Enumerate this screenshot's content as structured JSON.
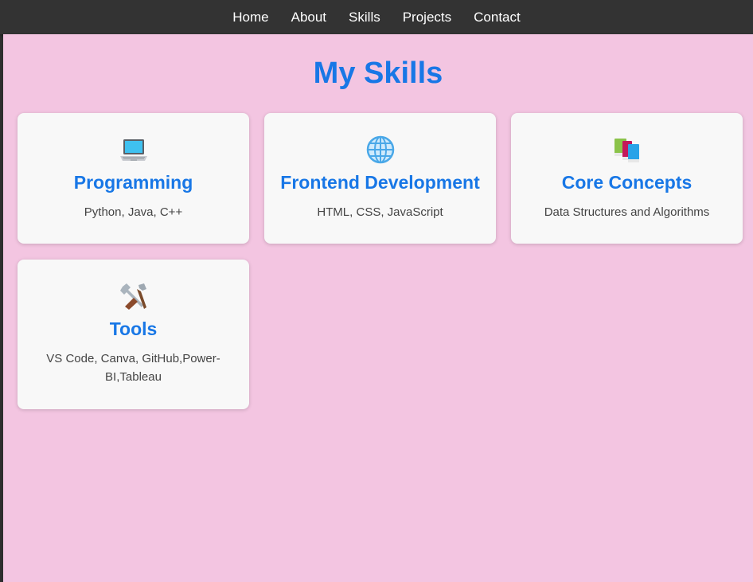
{
  "nav": {
    "items": [
      "Home",
      "About",
      "Skills",
      "Projects",
      "Contact"
    ]
  },
  "page": {
    "title": "My Skills",
    "background": "#f3c5e1",
    "accent": "#1877e6"
  },
  "skills": [
    {
      "icon": "laptop-icon",
      "title": "Programming",
      "description": "Python, Java, C++"
    },
    {
      "icon": "globe-icon",
      "title": "Frontend Development",
      "description": "HTML, CSS, JavaScript"
    },
    {
      "icon": "books-icon",
      "title": "Core Concepts",
      "description": "Data Structures and Algorithms"
    },
    {
      "icon": "tools-icon",
      "title": "Tools",
      "description": "VS Code, Canva, GitHub,Power-BI,Tableau"
    }
  ]
}
